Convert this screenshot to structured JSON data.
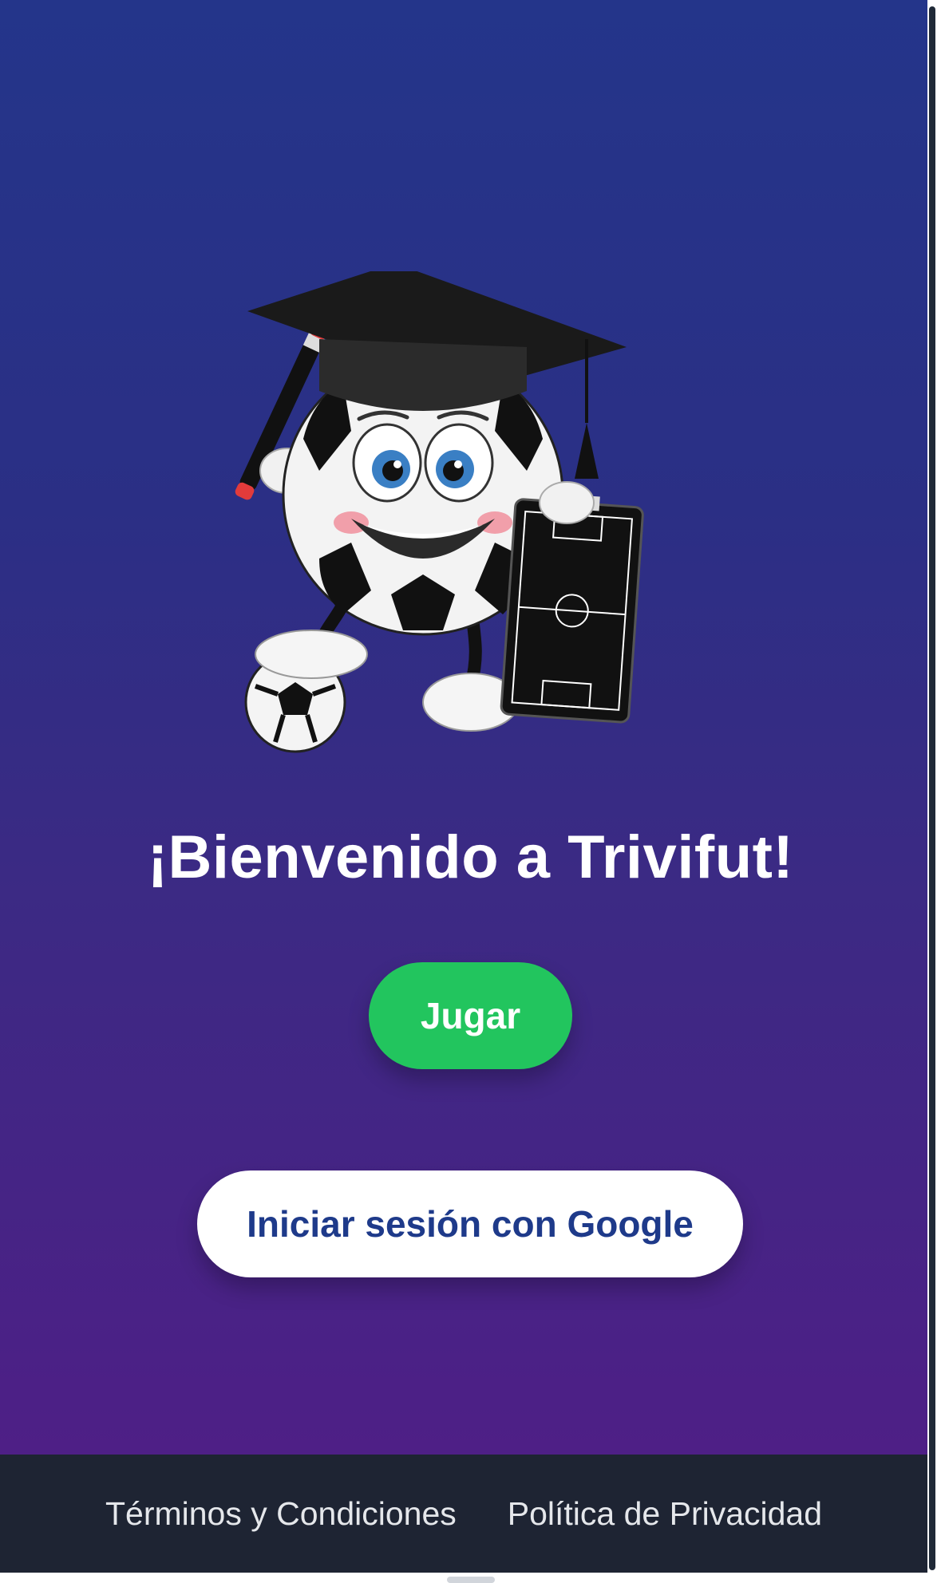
{
  "app": {
    "title": "¡Bienvenido a Trivifut!"
  },
  "mascot": {
    "icon": "soccer-ball-graduate-mascot"
  },
  "actions": {
    "play_label": "Jugar",
    "google_label": "Iniciar sesión con Google"
  },
  "footer": {
    "terms_label": "Términos y Condiciones",
    "privacy_label": "Política de Privacidad"
  },
  "colors": {
    "gradient_top": "#24358a",
    "gradient_bottom": "#4e1f86",
    "play_button": "#22c55e",
    "google_text": "#1e3a8a",
    "footer_bg": "#1e2433"
  }
}
